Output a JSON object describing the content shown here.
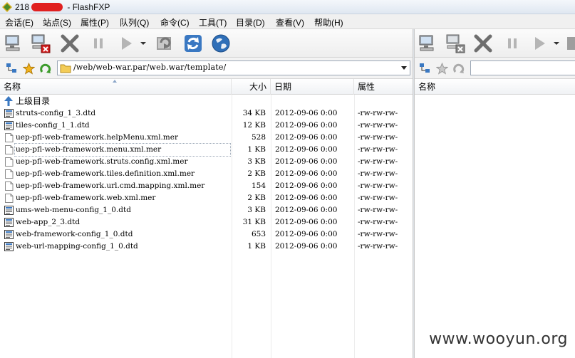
{
  "window": {
    "title_prefix": "218",
    "title_suffix": "FlashFXP"
  },
  "menu": [
    "会话(E)",
    "站点(S)",
    "属性(P)",
    "队列(Q)",
    "命令(C)",
    "工具(T)",
    "目录(D)",
    "查看(V)",
    "帮助(H)"
  ],
  "toolbar_icons": [
    "connect-icon",
    "disconnect-icon",
    "abort-icon",
    "pause-icon",
    "transfer-icon",
    "transfer-dropdown-icon",
    "refresh-queue-icon",
    "refresh-icon",
    "browser-icon"
  ],
  "left_pane": {
    "path": "/web/web-war.par/web.war/template/",
    "columns": {
      "name": "名称",
      "size": "大小",
      "date": "日期",
      "attr": "属性"
    },
    "updir_label": "上级目录",
    "files": [
      {
        "name": "struts-config_1_3.dtd",
        "size": "34 KB",
        "date": "2012-09-06  0:00",
        "attr": "-rw-rw-rw-",
        "icon": "dtd-file-icon"
      },
      {
        "name": "tiles-config_1_1.dtd",
        "size": "12 KB",
        "date": "2012-09-06  0:00",
        "attr": "-rw-rw-rw-",
        "icon": "dtd-file-icon"
      },
      {
        "name": "uep-pfl-web-framework.helpMenu.xml.mer",
        "size": "528",
        "date": "2012-09-06  0:00",
        "attr": "-rw-rw-rw-",
        "icon": "blank-file-icon"
      },
      {
        "name": "uep-pfl-web-framework.menu.xml.mer",
        "size": "1 KB",
        "date": "2012-09-06  0:00",
        "attr": "-rw-rw-rw-",
        "icon": "blank-file-icon"
      },
      {
        "name": "uep-pfl-web-framework.struts.config.xml.mer",
        "size": "3 KB",
        "date": "2012-09-06  0:00",
        "attr": "-rw-rw-rw-",
        "icon": "blank-file-icon"
      },
      {
        "name": "uep-pfl-web-framework.tiles.definition.xml.mer",
        "size": "2 KB",
        "date": "2012-09-06  0:00",
        "attr": "-rw-rw-rw-",
        "icon": "blank-file-icon"
      },
      {
        "name": "uep-pfl-web-framework.url.cmd.mapping.xml.mer",
        "size": "154",
        "date": "2012-09-06  0:00",
        "attr": "-rw-rw-rw-",
        "icon": "blank-file-icon"
      },
      {
        "name": "uep-pfl-web-framework.web.xml.mer",
        "size": "2 KB",
        "date": "2012-09-06  0:00",
        "attr": "-rw-rw-rw-",
        "icon": "blank-file-icon"
      },
      {
        "name": "ums-web-menu-config_1_0.dtd",
        "size": "3 KB",
        "date": "2012-09-06  0:00",
        "attr": "-rw-rw-rw-",
        "icon": "dtd-file-icon"
      },
      {
        "name": "web-app_2_3.dtd",
        "size": "31 KB",
        "date": "2012-09-06  0:00",
        "attr": "-rw-rw-rw-",
        "icon": "dtd-file-icon"
      },
      {
        "name": "web-framework-config_1_0.dtd",
        "size": "653",
        "date": "2012-09-06  0:00",
        "attr": "-rw-rw-rw-",
        "icon": "dtd-file-icon"
      },
      {
        "name": "web-url-mapping-config_1_0.dtd",
        "size": "1 KB",
        "date": "2012-09-06  0:00",
        "attr": "-rw-rw-rw-",
        "icon": "dtd-file-icon"
      }
    ],
    "selected_index": 3
  },
  "right_pane": {
    "columns": {
      "name": "名称"
    }
  },
  "watermark": "www.wooyun.org",
  "colors": {
    "accent": "#3a78c2",
    "title_bg": "#dfe7f1",
    "redaction": "#e02020"
  }
}
